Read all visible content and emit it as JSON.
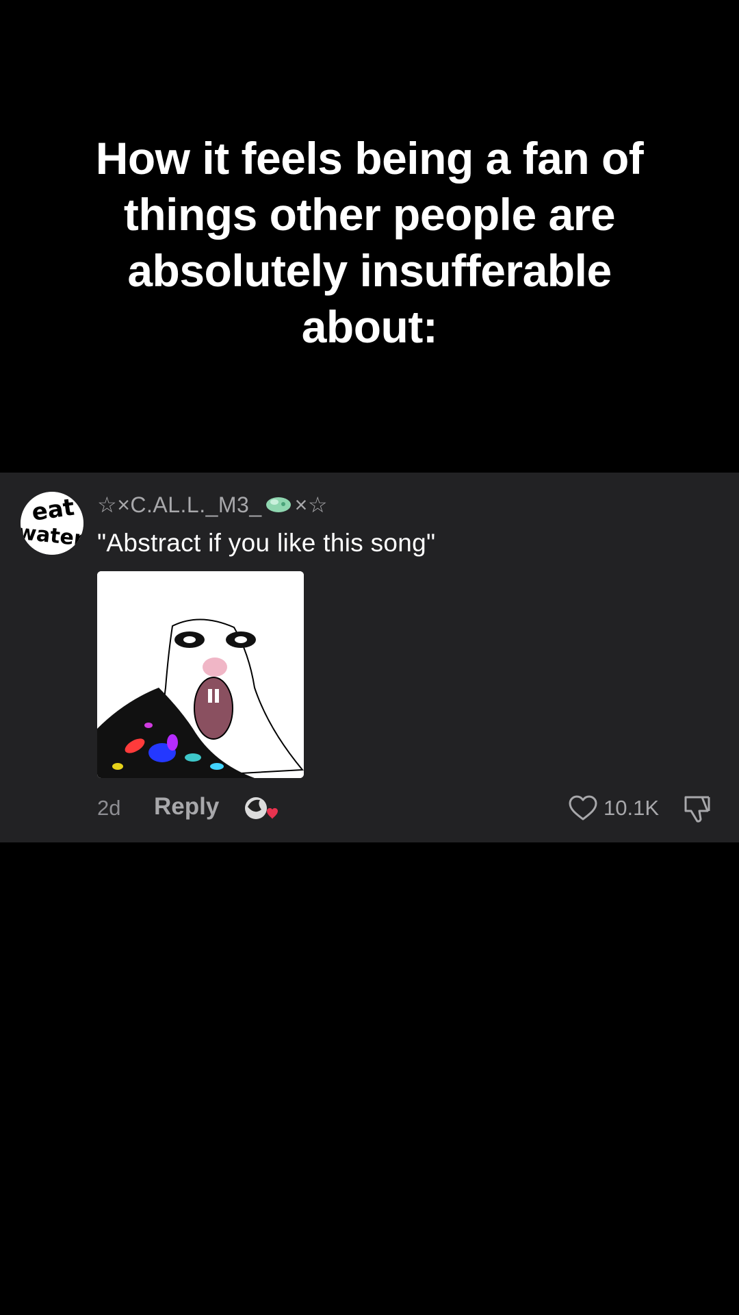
{
  "video": {
    "caption_lines": [
      "How it feels being a fan of",
      "things other people are",
      "absolutely insufferable",
      "about:"
    ]
  },
  "comment": {
    "avatar_text_top": "eat",
    "avatar_text_bottom": "water",
    "username_prefix": "☆×C.AL.L._M3_",
    "username_suffix": "×☆",
    "username_emoji": "green-blob-emoji",
    "text": "\"Abstract if you like this song\"",
    "sticker": "abstract-face-sticker",
    "time": "2d",
    "reply_label": "Reply",
    "like_count": "10.1K",
    "liked_by_creator": true
  },
  "colors": {
    "background": "#000000",
    "card": "#222224",
    "muted_text": "#a8a8ab",
    "heart_red": "#e8334f"
  }
}
